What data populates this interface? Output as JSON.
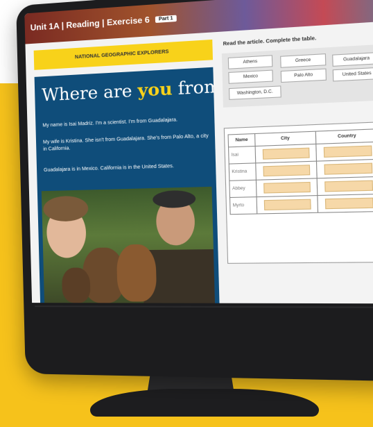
{
  "topbar": {
    "title": "Unit 1A | Reading | Exercise 6",
    "part_badge": "Part 1"
  },
  "article": {
    "banner": "NATIONAL GEOGRAPHIC EXPLORERS",
    "heading_pre": "Where are ",
    "heading_hl": "you",
    "heading_post": " from?",
    "paragraphs": [
      "My name is Isai Madriz. I'm a scientist. I'm from Guadalajara.",
      "My wife is Kristina. She isn't from Guadalajara. She's from Palo Alto, a city in California.",
      "Guadalajara is in Mexico. California is in the United States."
    ]
  },
  "exercise": {
    "instruction": "Read the article. Complete the table.",
    "chips": [
      "Athens",
      "Greece",
      "Guadalajara",
      "Mexico",
      "Palo Alto",
      "United States",
      "Washington, D.C."
    ],
    "table": {
      "headers": [
        "Name",
        "City",
        "Country"
      ],
      "rows": [
        "Isai",
        "Kristina",
        "Abbey",
        "Myrto"
      ]
    }
  },
  "colors": {
    "brand_yellow": "#f6c21b",
    "article_blue": "#0f4d7a",
    "answer_slot": "#f6d8a8"
  }
}
